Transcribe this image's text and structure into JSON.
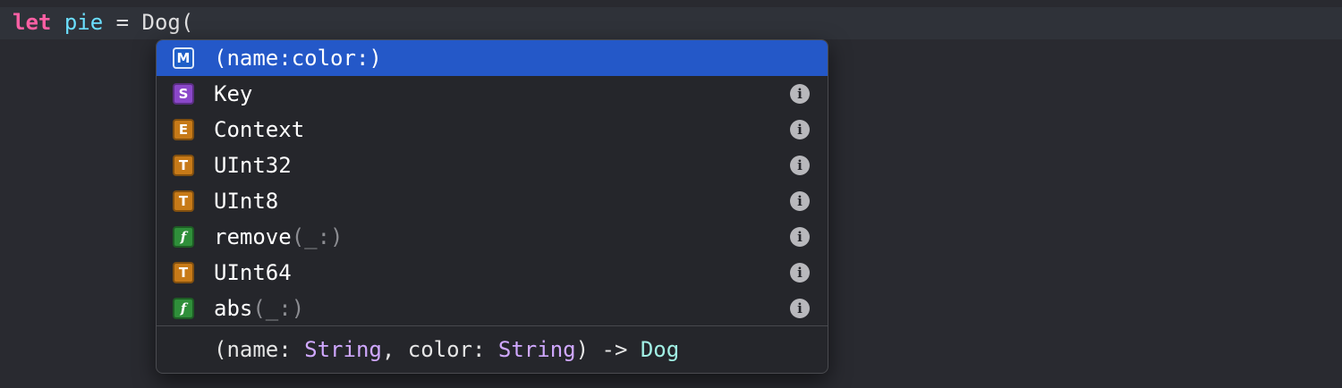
{
  "editor": {
    "keyword": "let",
    "identifier": "pie",
    "equals": "=",
    "call_text": "Dog("
  },
  "colors": {
    "method_badge": "#1f5fc8",
    "struct_badge": "#8a47c9",
    "enum_badge": "#c77a18",
    "typealias_badge": "#c77a18",
    "function_badge": "#2f8f3a",
    "selection": "#2458c8"
  },
  "completions": [
    {
      "badge": "M",
      "badge_kind": "method",
      "name": "(name:color:)",
      "suffix": "",
      "has_info": false,
      "selected": true
    },
    {
      "badge": "S",
      "badge_kind": "struct",
      "name": "Key",
      "suffix": "",
      "has_info": true,
      "selected": false
    },
    {
      "badge": "E",
      "badge_kind": "enum",
      "name": "Context",
      "suffix": "",
      "has_info": true,
      "selected": false
    },
    {
      "badge": "T",
      "badge_kind": "typealias",
      "name": "UInt32",
      "suffix": "",
      "has_info": true,
      "selected": false
    },
    {
      "badge": "T",
      "badge_kind": "typealias",
      "name": "UInt8",
      "suffix": "",
      "has_info": true,
      "selected": false
    },
    {
      "badge": "f",
      "badge_kind": "function",
      "name": "remove",
      "suffix": "(_:)",
      "has_info": true,
      "selected": false
    },
    {
      "badge": "T",
      "badge_kind": "typealias",
      "name": "UInt64",
      "suffix": "",
      "has_info": true,
      "selected": false
    },
    {
      "badge": "f",
      "badge_kind": "function",
      "name": "abs",
      "suffix": "(_:)",
      "has_info": true,
      "selected": false
    }
  ],
  "info_icon_glyph": "i",
  "signature": {
    "open": "(name: ",
    "type1": "String",
    "mid": ", color: ",
    "type2": "String",
    "close": ") -> ",
    "return_type": "Dog"
  }
}
